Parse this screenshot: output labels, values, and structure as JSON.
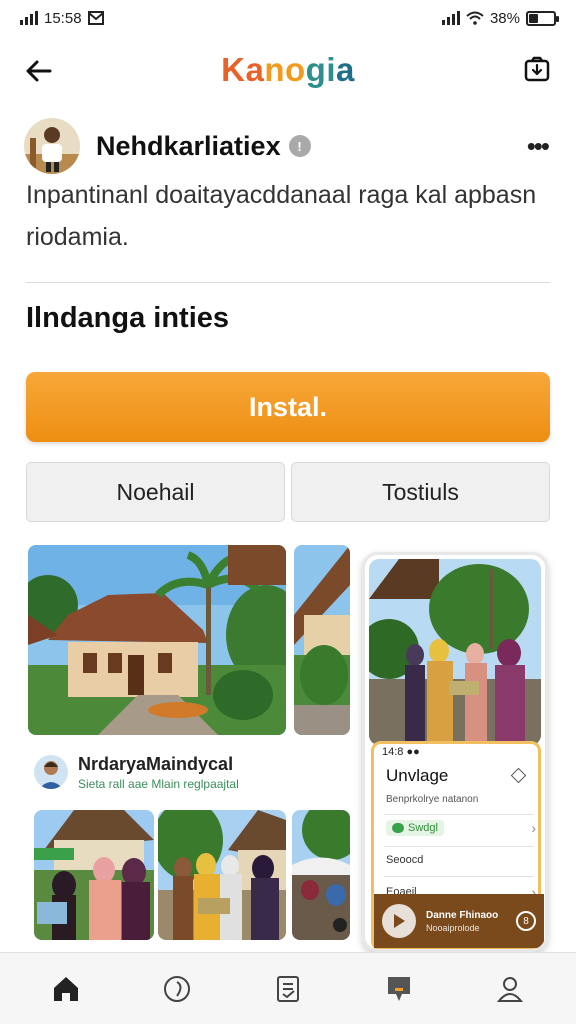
{
  "status_bar": {
    "time": "15:58",
    "battery": "38%"
  },
  "header": {
    "brand": [
      "Ka",
      "no",
      "gi",
      "a"
    ]
  },
  "profile": {
    "name": "Nehdkarliatiex",
    "description": "Inpantinanl doaitayacddanaal raga kal apbasn riodamia."
  },
  "section": {
    "title": "Ilndanga inties"
  },
  "actions": {
    "install": "Instal.",
    "secondary_left": "Noehail",
    "secondary_right": "Tostiuls"
  },
  "author": {
    "name": "NrdaryaMaindycal",
    "subtitle": "Sieta rall aae Mlain reglpaajtal"
  },
  "phone_card": {
    "status": "14:8  ●●",
    "title": "Unvlage",
    "subtitle": "Benprkolrye natanon",
    "pill": "Swdgl",
    "row1": "Seoocd",
    "row2": "Eoaeil",
    "player_title": "Danne Fhinaoo",
    "player_sub": "Nooaiprolode",
    "player_badge": "8"
  },
  "bottom_nav": [
    "home-icon",
    "compass-icon",
    "document-icon",
    "chat-icon",
    "profile-icon"
  ],
  "colors": {
    "accent": "#ee8e12",
    "brand_orange": "#e8622a",
    "brand_teal": "#2f8f8b"
  }
}
